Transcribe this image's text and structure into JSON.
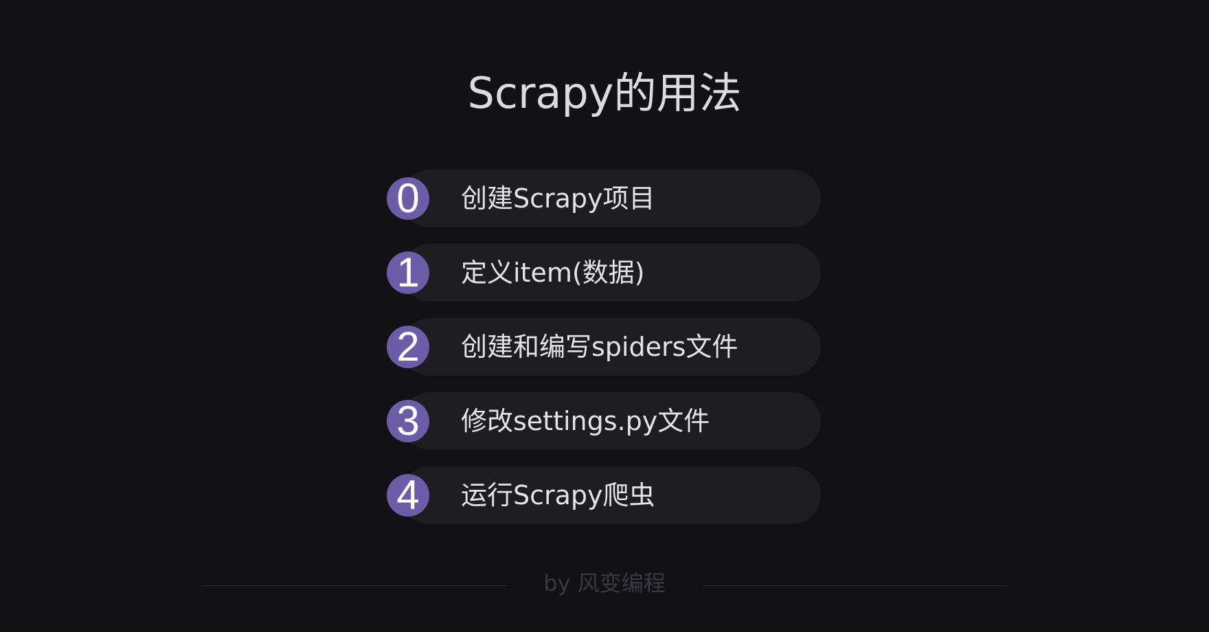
{
  "title": "Scrapy的用法",
  "steps": [
    {
      "number": "0",
      "label": "创建Scrapy项目"
    },
    {
      "number": "1",
      "label": "定义item(数据)"
    },
    {
      "number": "2",
      "label": "创建和编写spiders文件"
    },
    {
      "number": "3",
      "label": "修改settings.py文件"
    },
    {
      "number": "4",
      "label": "运行Scrapy爬虫"
    }
  ],
  "footer": {
    "text": "by 风变编程"
  },
  "colors": {
    "background": "#111116",
    "pill": "#1d1d22",
    "badge": "#6c5da8",
    "title_text": "#dcdce0",
    "footer_text": "#3a3a42"
  }
}
